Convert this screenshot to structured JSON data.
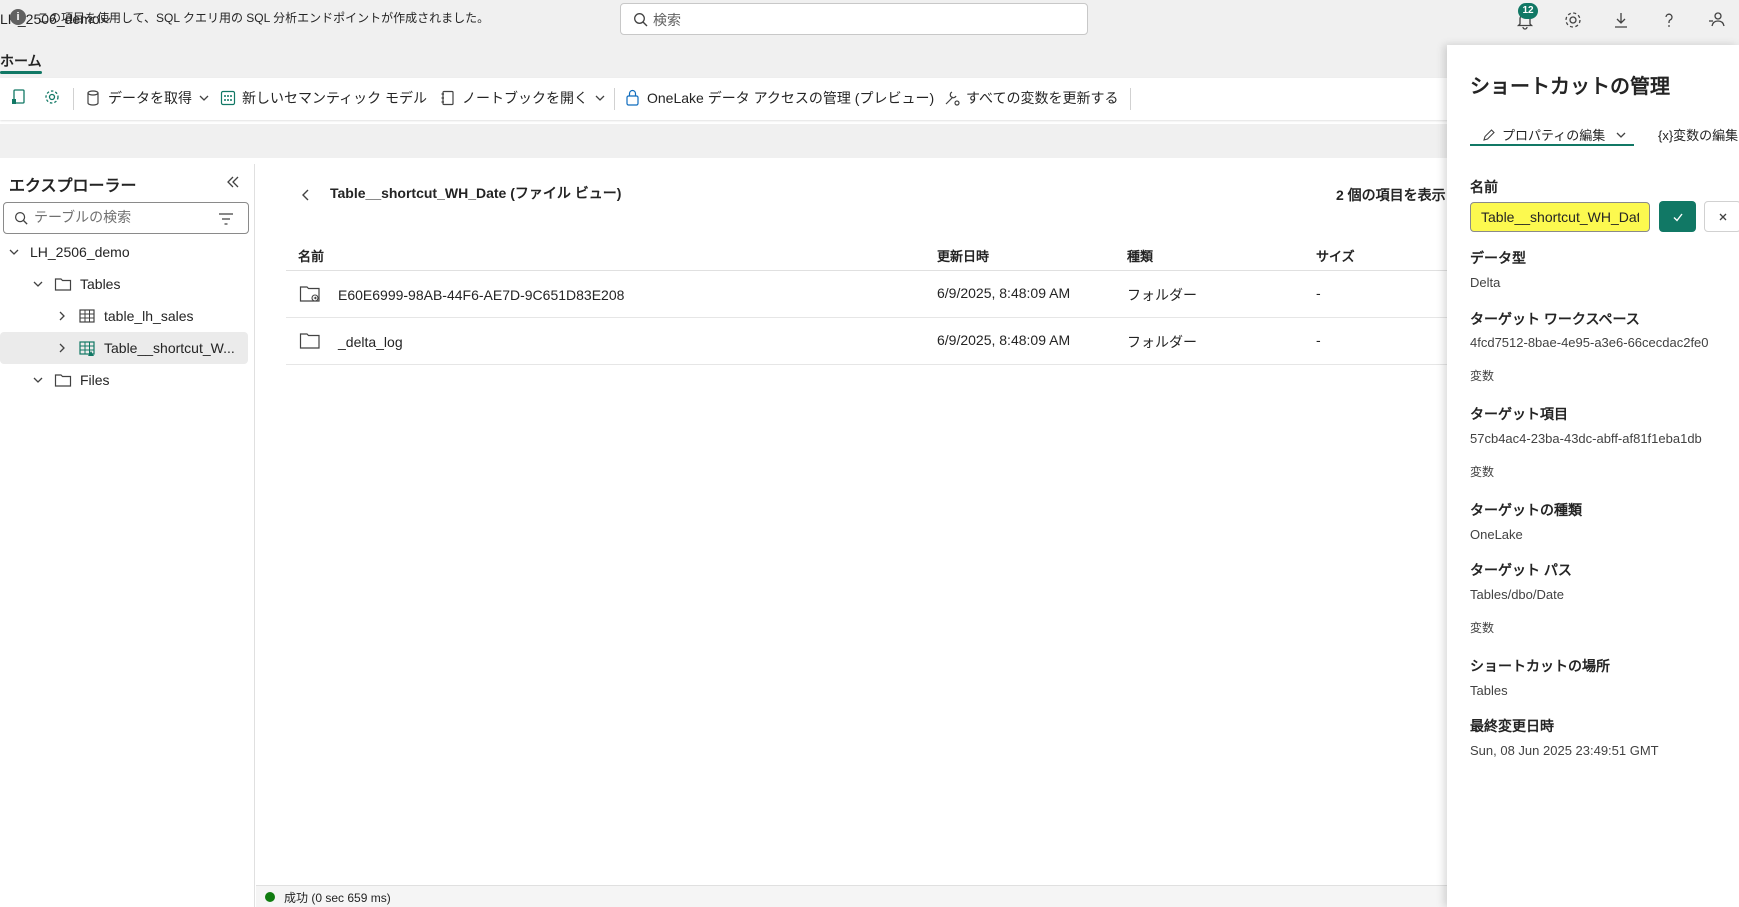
{
  "header": {
    "workspace_name": "LH_2506_demo",
    "search_placeholder": "検索",
    "notification_count": "12"
  },
  "tabs": {
    "home": "ホーム"
  },
  "toolbar": {
    "get_data": "データを取得",
    "new_semantic_model": "新しいセマンティック モデル",
    "open_notebook": "ノートブックを開く",
    "onelake_access": "OneLake データ アクセスの管理 (プレビュー)",
    "update_all_variables": "すべての変数を更新する"
  },
  "info_bar": {
    "message": "この項目を使用して、SQL クエリ用の SQL 分析エンドポイントが作成されました。"
  },
  "explorer": {
    "title": "エクスプローラー",
    "search_placeholder": "テーブルの検索",
    "tree": {
      "lakehouse": "LH_2506_demo",
      "tables": "Tables",
      "table_lh_sales": "table_lh_sales",
      "table_shortcut": "Table__shortcut_W...",
      "files": "Files"
    }
  },
  "main": {
    "title": "Table__shortcut_WH_Date (ファイル ビュー)",
    "item_count": "2 個の項目を表示",
    "columns": [
      "名前",
      "更新日時",
      "種類",
      "サイズ"
    ],
    "rows": [
      {
        "name": "E60E6999-98AB-44F6-AE7D-9C651D83E208",
        "modified": "6/9/2025, 8:48:09 AM",
        "type": "フォルダー",
        "size": "-"
      },
      {
        "name": "_delta_log",
        "modified": "6/9/2025, 8:48:09 AM",
        "type": "フォルダー",
        "size": "-"
      }
    ]
  },
  "status": {
    "text": "成功 (0 sec 659 ms)"
  },
  "panel": {
    "title": "ショートカットの管理",
    "tab_edit_properties": "プロパティの編集",
    "tab_edit_variables": "{x}変数の編集",
    "name_label": "名前",
    "name_value": "Table__shortcut_WH_Date",
    "data_type_label": "データ型",
    "data_type_value": "Delta",
    "target_workspace_label": "ターゲット ワークスペース",
    "target_workspace_value": "4fcd7512-8bae-4e95-a3e6-66cecdac2fe0",
    "variable_label": "変数",
    "target_item_label": "ターゲット項目",
    "target_item_value": "57cb4ac4-23ba-43dc-abff-af81f1eba1db",
    "target_type_label": "ターゲットの種類",
    "target_type_value": "OneLake",
    "target_path_label": "ターゲット パス",
    "target_path_value": "Tables/dbo/Date",
    "shortcut_location_label": "ショートカットの場所",
    "shortcut_location_value": "Tables",
    "last_modified_label": "最終変更日時",
    "last_modified_value": "Sun, 08 Jun 2025 23:49:51 GMT"
  },
  "colors": {
    "accent": "#117865",
    "highlight": "#fcf94f",
    "success": "#107c10"
  },
  "icons": [
    "search-icon",
    "bell-icon",
    "gear-icon",
    "download-icon",
    "help-icon",
    "share-icon",
    "folder-icon",
    "table-icon",
    "shortcut-table-icon",
    "chevron-down-icon",
    "chevron-right-icon",
    "back-icon",
    "filter-icon",
    "collapse-icon",
    "pencil-icon",
    "check-icon",
    "close-icon",
    "info-icon"
  ]
}
